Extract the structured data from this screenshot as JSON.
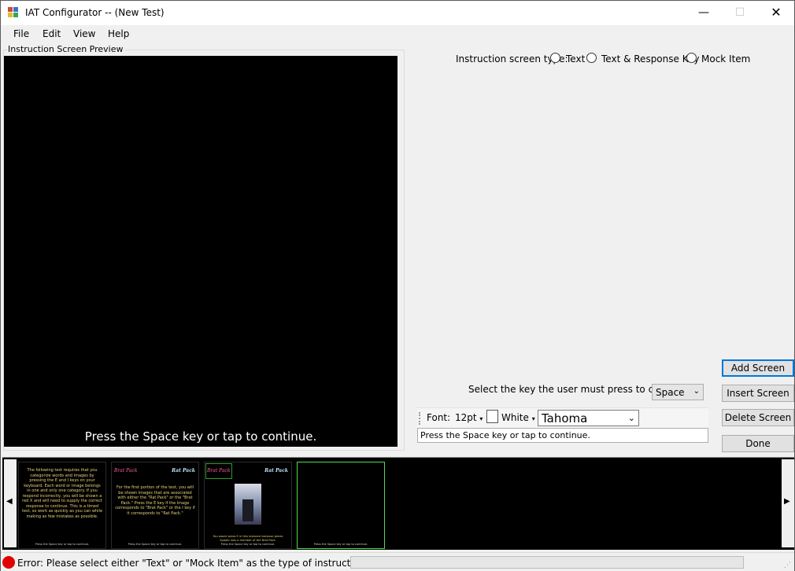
{
  "window": {
    "title": "IAT Configurator -- (New Test)"
  },
  "menu": {
    "file": "File",
    "edit": "Edit",
    "view": "View",
    "help": "Help"
  },
  "preview": {
    "group_label": "Instruction Screen Preview",
    "continue_text": "Press the Space key or tap to continue."
  },
  "screen_type": {
    "label": "Instruction screen type:",
    "options": [
      "Text",
      "Text & Response Key",
      "Mock Item"
    ]
  },
  "continue_key": {
    "label": "Select the key the user must press to continue:",
    "value": "Space"
  },
  "buttons": {
    "add": "Add Screen",
    "insert": "Insert Screen",
    "delete": "Delete Screen",
    "done": "Done"
  },
  "format_toolbar": {
    "font_label": "Font:",
    "size": "12pt",
    "color_name": "White",
    "font_name": "Tahoma"
  },
  "text_box": {
    "value": "Press the Space key or tap to continue."
  },
  "thumbnails": [
    {
      "text": "The following test requires that you categorize words and images by pressing the E and I keys on your keyboard. Each word or image belongs in one and only one category. If you respond incorrectly, you will be shown a red X and will need to supply the correct response to continue. This is a timed test, so work as quickly as you can while making as few mistakes as possible.",
      "footer": "Press the Space key or tap to continue."
    },
    {
      "label_left": "Brat Pack",
      "label_right": "Rat Pack",
      "text": "For the first portion of the test, you will be shown images that are associated with either the \"Rat Pack\" or the \"Brat Pack.\" Press the E key if the image corresponds to \"Brat Pack\" or the I key if it corresponds to \"Rat Pack.\"",
      "footer": "Press the Space key or tap to continue."
    },
    {
      "label_left": "Brat Pack",
      "label_right": "Rat Pack",
      "text": "You would press E in this instance because James Spader was a member of the Brat Pack.",
      "footer": "Press the Space key or tap to continue."
    },
    {
      "footer": "Press the Space key or tap to continue."
    }
  ],
  "status": {
    "message": "Error: Please select either \"Text\" or \"Mock Item\" as the type of instruction screen"
  },
  "icons": [
    "app-icon",
    "minimize-icon",
    "maximize-icon",
    "close-icon",
    "scroll-left-icon",
    "scroll-right-icon",
    "error-icon",
    "dropdown-arrow-icon"
  ]
}
